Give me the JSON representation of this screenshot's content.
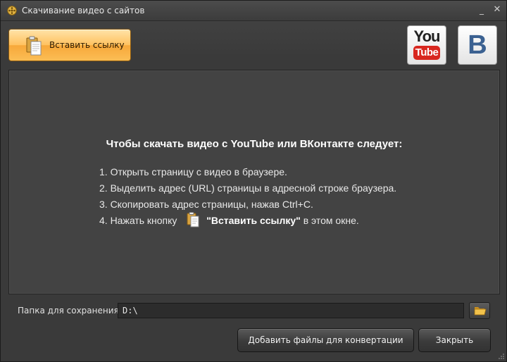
{
  "window": {
    "title": "Скачивание видео с сайтов",
    "minimize_glyph": "_",
    "close_glyph": "✕"
  },
  "toolbar": {
    "paste_label": "Вставить ссылку",
    "youtube": {
      "top": "You",
      "bottom": "Tube"
    },
    "vk": {
      "letter": "В"
    }
  },
  "instructions": {
    "title": "Чтобы скачать видео с YouTube или ВКонтакте следует:",
    "steps": [
      "1. Открыть страницу с видео в браузере.",
      "2. Выделить адрес (URL) страницы в адресной строке браузера.",
      "3. Скопировать адрес страницы, нажав Ctrl+C."
    ],
    "step4_prefix": "4. Нажать кнопку",
    "step4_button": "\"Вставить ссылку\"",
    "step4_suffix": "в этом окне."
  },
  "save_folder": {
    "label": "Папка для сохранения:",
    "value": "D:\\"
  },
  "buttons": {
    "add_files": "Добавить файлы для конвертации",
    "close": "Закрыть"
  },
  "colors": {
    "accent_orange": "#ffc260",
    "youtube_red": "#d8271f",
    "vk_blue": "#3b6191",
    "panel_bg": "#434343"
  }
}
